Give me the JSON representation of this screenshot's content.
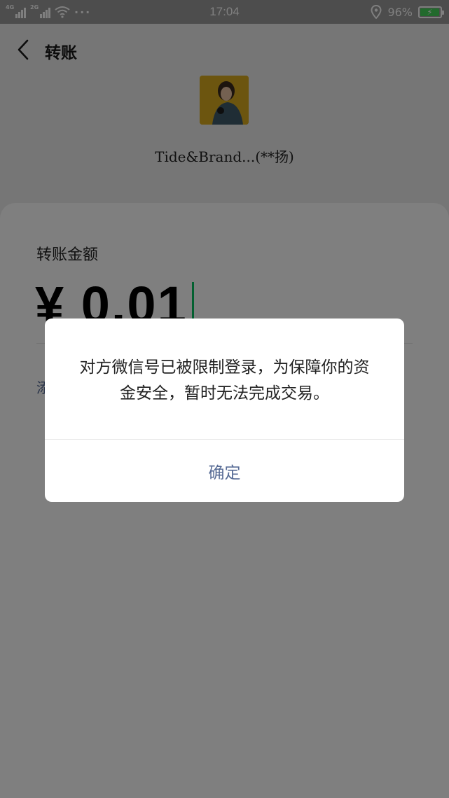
{
  "status_bar": {
    "net1": "4G",
    "net2": "2G",
    "more": "···",
    "time": "17:04",
    "battery_percent": "96%",
    "battery_level": 0.96
  },
  "header": {
    "title": "转账"
  },
  "payee": {
    "name": "Tide&Brand...(**扬)"
  },
  "transfer": {
    "amount_label": "转账金额",
    "amount": "¥ 0.01",
    "remark_text": "添"
  },
  "dialog": {
    "message": "对方微信号已被限制登录，为保障你的资金安全，暂时无法完成交易。",
    "confirm_label": "确定"
  },
  "colors": {
    "accent_green": "#07c160",
    "link_blue": "#576b95",
    "battery_green": "#45d45a"
  }
}
